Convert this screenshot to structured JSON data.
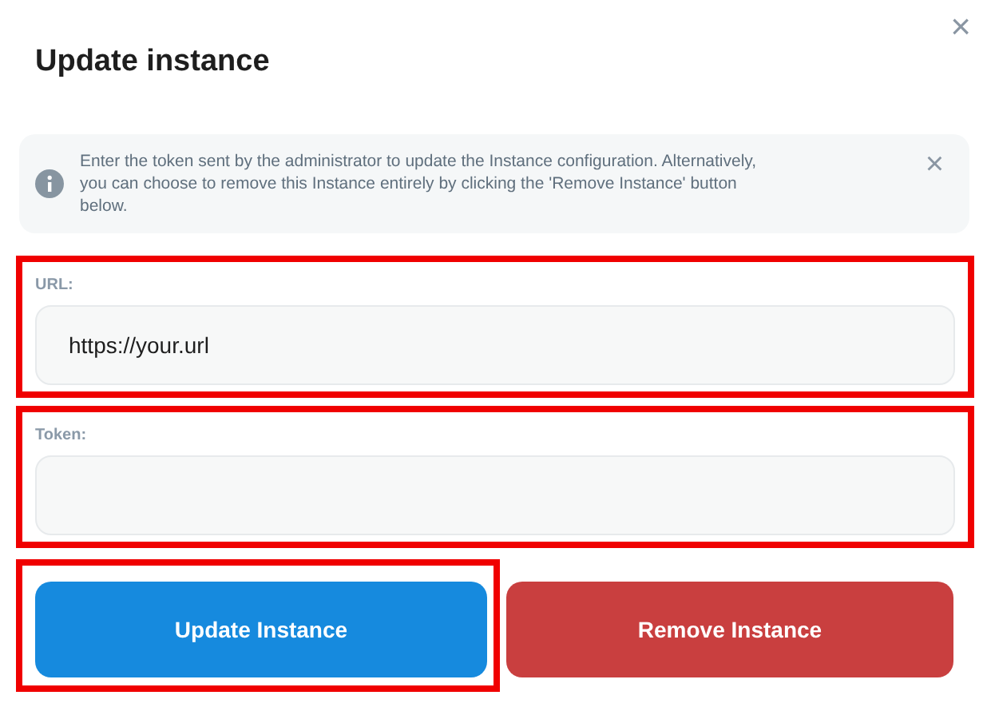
{
  "dialog": {
    "title": "Update instance",
    "close": "×"
  },
  "alert": {
    "text": "Enter the token sent by the administrator to update the Instance configuration. Alternatively, you can choose to remove this Instance entirely by clicking the 'Remove Instance' button below.",
    "close": "×"
  },
  "fields": [
    {
      "label": "URL:",
      "value": "https://your.url",
      "highlighted": true
    },
    {
      "label": "Token:",
      "highlighted": true
    }
  ],
  "buttons": [
    {
      "label": "Update Instance",
      "kind": "primary",
      "highlighted": true
    },
    {
      "label": "Remove Instance",
      "kind": "danger",
      "highlighted": false
    }
  ]
}
